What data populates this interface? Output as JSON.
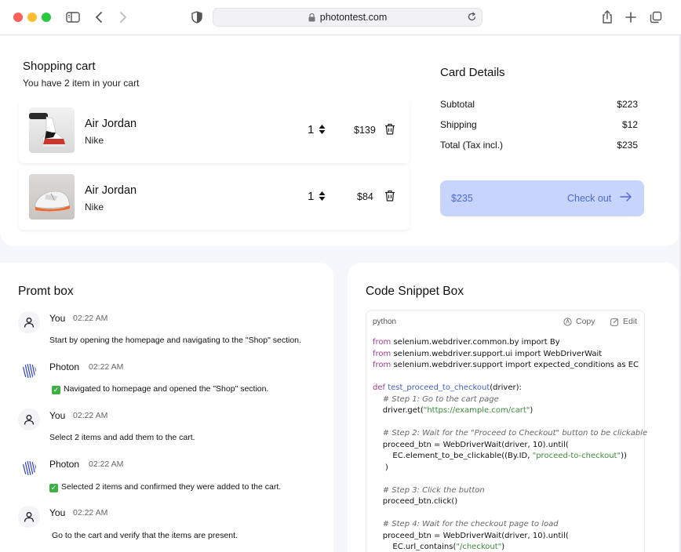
{
  "browser": {
    "url": "photontest.com"
  },
  "cart": {
    "title": "Shopping cart",
    "subtitle": "You have 2 item in your cart",
    "items": [
      {
        "name": "Air Jordan",
        "brand": "Nike",
        "qty": "1",
        "price": "$139"
      },
      {
        "name": "Air Jordan",
        "brand": "Nike",
        "qty": "1",
        "price": "$84"
      }
    ]
  },
  "card": {
    "title": "Card Details",
    "rows": [
      {
        "label": "Subtotal",
        "value": "$223"
      },
      {
        "label": "Shipping",
        "value": "$12"
      },
      {
        "label": "Total (Tax incl.)",
        "value": "$235"
      }
    ],
    "checkout_total": "$235",
    "checkout_label": "Check out"
  },
  "prompt": {
    "title": "Promt box",
    "messages": [
      {
        "author": "You",
        "time": "02:22 AM",
        "text": "Start by opening the homepage and navigating to the \"Shop\" section."
      },
      {
        "author": "Photon",
        "time": "02:22 AM",
        "text": "Navigated to homepage and opened the \"Shop\" section."
      },
      {
        "author": "You",
        "time": "02:22 AM",
        "text": "Select 2 items and add them to the cart."
      },
      {
        "author": "Photon",
        "time": "02:22 AM",
        "text": "Selected 2 items and confirmed they were added to the cart."
      },
      {
        "author": "You",
        "time": "02:22 AM",
        "text": "Go to the cart and verify that the items are present."
      }
    ]
  },
  "code": {
    "title": "Code Snippet Box",
    "language": "python",
    "copy_label": "Copy",
    "edit_label": "Edit",
    "lines": [
      {
        "seg": [
          {
            "k": "kw",
            "t": "from"
          },
          {
            "k": "",
            "t": " selenium.webdriver.common.by import By"
          }
        ]
      },
      {
        "seg": [
          {
            "k": "kw",
            "t": "from"
          },
          {
            "k": "",
            "t": " selenium.webdriver.support.ui import WebDriverWait"
          }
        ]
      },
      {
        "seg": [
          {
            "k": "kw",
            "t": "from"
          },
          {
            "k": "",
            "t": " selenium.webdriver.support import expected_conditions as EC"
          }
        ]
      },
      {
        "seg": []
      },
      {
        "seg": [
          {
            "k": "kw",
            "t": "def"
          },
          {
            "k": "",
            "t": " "
          },
          {
            "k": "fn",
            "t": "test_proceed_to_checkout"
          },
          {
            "k": "",
            "t": "(driver):"
          }
        ]
      },
      {
        "seg": [
          {
            "k": "cm",
            "t": "    # Step 1: Go to the cart page"
          }
        ]
      },
      {
        "seg": [
          {
            "k": "",
            "t": "    driver.get("
          },
          {
            "k": "str",
            "t": "\"https://example.com/cart\""
          },
          {
            "k": "",
            "t": ")"
          }
        ]
      },
      {
        "seg": []
      },
      {
        "seg": [
          {
            "k": "cm",
            "t": "    # Step 2: Wait for the \"Proceed to Checkout\" button to be clickable"
          }
        ]
      },
      {
        "seg": [
          {
            "k": "",
            "t": "    proceed_btn = WebDriverWait(driver, 10).until("
          }
        ]
      },
      {
        "seg": [
          {
            "k": "",
            "t": "        EC.element_to_be_clickable((By.ID, "
          },
          {
            "k": "str",
            "t": "\"proceed-to-checkout\""
          },
          {
            "k": "",
            "t": "))"
          }
        ]
      },
      {
        "seg": [
          {
            "k": "",
            "t": "     )"
          }
        ]
      },
      {
        "seg": []
      },
      {
        "seg": [
          {
            "k": "cm",
            "t": "    # Step 3: Click the button"
          }
        ]
      },
      {
        "seg": [
          {
            "k": "",
            "t": "    proceed_btn.click()"
          }
        ]
      },
      {
        "seg": []
      },
      {
        "seg": [
          {
            "k": "cm",
            "t": "    # Step 4: Wait for the checkout page to load"
          }
        ]
      },
      {
        "seg": [
          {
            "k": "",
            "t": "    proceed_btn = WebDriverWait(driver, 10).until("
          }
        ]
      },
      {
        "seg": [
          {
            "k": "",
            "t": "        EC.url_contains("
          },
          {
            "k": "str",
            "t": "\"/checkout\""
          },
          {
            "k": "",
            "t": ")"
          }
        ]
      }
    ]
  }
}
